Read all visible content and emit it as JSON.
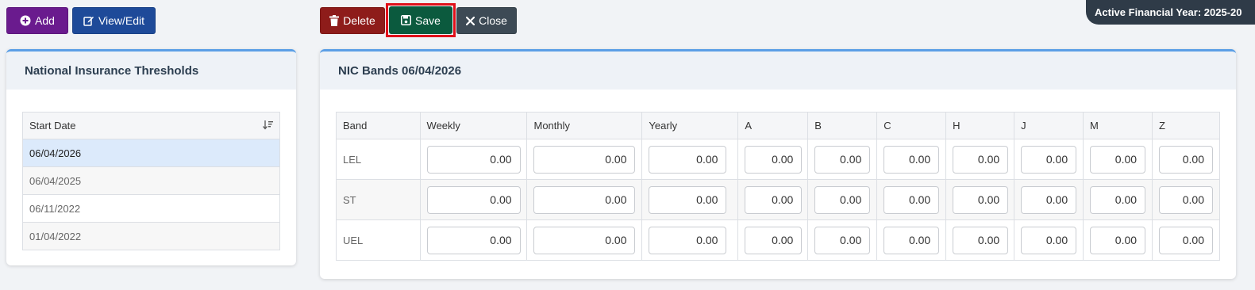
{
  "toolbar": {
    "add_label": "Add",
    "view_edit_label": "View/Edit",
    "delete_label": "Delete",
    "save_label": "Save",
    "close_label": "Close"
  },
  "financial_year": {
    "label": "Active Financial Year: 2025-20"
  },
  "thresholds_panel": {
    "title": "National Insurance Thresholds",
    "column_header": "Start Date",
    "dates": [
      "06/04/2026",
      "06/04/2025",
      "06/11/2022",
      "01/04/2022"
    ],
    "selected_index": 0
  },
  "bands_panel": {
    "title": "NIC Bands 06/04/2026",
    "columns": [
      "Band",
      "Weekly",
      "Monthly",
      "Yearly",
      "A",
      "B",
      "C",
      "H",
      "J",
      "M",
      "Z"
    ],
    "rows": [
      {
        "band": "LEL",
        "values": [
          "0.00",
          "0.00",
          "0.00",
          "0.00",
          "0.00",
          "0.00",
          "0.00",
          "0.00",
          "0.00",
          "0.00"
        ]
      },
      {
        "band": "ST",
        "values": [
          "0.00",
          "0.00",
          "0.00",
          "0.00",
          "0.00",
          "0.00",
          "0.00",
          "0.00",
          "0.00",
          "0.00"
        ]
      },
      {
        "band": "UEL",
        "values": [
          "0.00",
          "0.00",
          "0.00",
          "0.00",
          "0.00",
          "0.00",
          "0.00",
          "0.00",
          "0.00",
          "0.00"
        ]
      }
    ]
  },
  "colors": {
    "add": "#6a1b8e",
    "view_edit": "#1e4a99",
    "delete": "#8e1c1a",
    "save": "#0b5a3e",
    "close": "#3d4a55",
    "highlight": "#e0101a",
    "panel_accent": "#5b9fe6"
  }
}
